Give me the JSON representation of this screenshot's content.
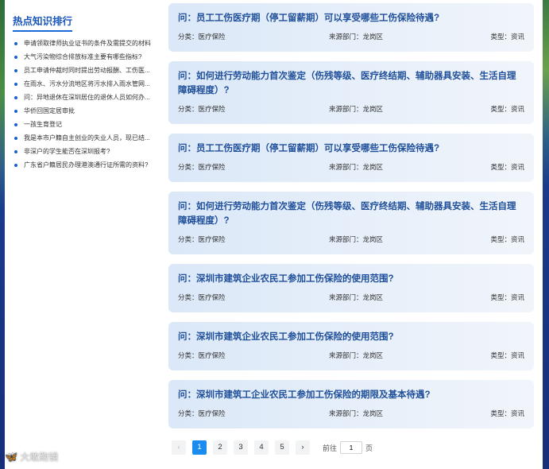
{
  "sidebar": {
    "title": "热点知识排行",
    "items": [
      "申请领取律师执业证书的条件及需提交的材料",
      "大气污染物综合排放标准主要有哪些指标?",
      "员工申请仲裁时同时提出劳动报酬、工伤医...",
      "在雨水、污水分流地区将污水排入雨水管网...",
      "问：异地退休在深圳居住的退休人员如何办...",
      "华侨回国定居审批",
      "一孩生育登记",
      "我是本市户籍自主创业的失业人员，现已结...",
      "非深户的学生能否在深圳报考?",
      "广东省户籍居民办理港澳通行证所需的资料?"
    ]
  },
  "cards": [
    {
      "q": "问：员工工伤医疗期（停工留薪期）可以享受哪些工伤保险待遇?",
      "cat": "分类：医疗保险",
      "src": "来源部门：龙岗区",
      "type": "类型：资讯"
    },
    {
      "q": "问：如何进行劳动能力首次鉴定（伤残等级、医疗终结期、辅助器具安装、生活自理障碍程度）?",
      "cat": "分类：医疗保险",
      "src": "来源部门：龙岗区",
      "type": "类型：资讯"
    },
    {
      "q": "问：员工工伤医疗期（停工留薪期）可以享受哪些工伤保险待遇?",
      "cat": "分类：医疗保险",
      "src": "来源部门：龙岗区",
      "type": "类型：资讯"
    },
    {
      "q": "问：如何进行劳动能力首次鉴定（伤残等级、医疗终结期、辅助器具安装、生活自理障碍程度）?",
      "cat": "分类：医疗保险",
      "src": "来源部门：龙岗区",
      "type": "类型：资讯"
    },
    {
      "q": "问：深圳市建筑企业农民工参加工伤保险的使用范围?",
      "cat": "分类：医疗保险",
      "src": "来源部门：龙岗区",
      "type": "类型：资讯"
    },
    {
      "q": "问：深圳市建筑企业农民工参加工伤保险的使用范围?",
      "cat": "分类：医疗保险",
      "src": "来源部门：龙岗区",
      "type": "类型：资讯"
    },
    {
      "q": "问：深圳市建筑工企业农民工参加工伤保险的期限及基本待遇?",
      "cat": "分类：医疗保险",
      "src": "来源部门：龙岗区",
      "type": "类型：资讯"
    }
  ],
  "pagination": {
    "prev": "‹",
    "pages": [
      "1",
      "2",
      "3",
      "4",
      "5"
    ],
    "active_page": "1",
    "next": "›",
    "goto_prefix": "前往",
    "goto_value": "1",
    "goto_suffix": "页"
  },
  "watermark": {
    "icon": "🦋",
    "text": "大敢跑镜"
  }
}
